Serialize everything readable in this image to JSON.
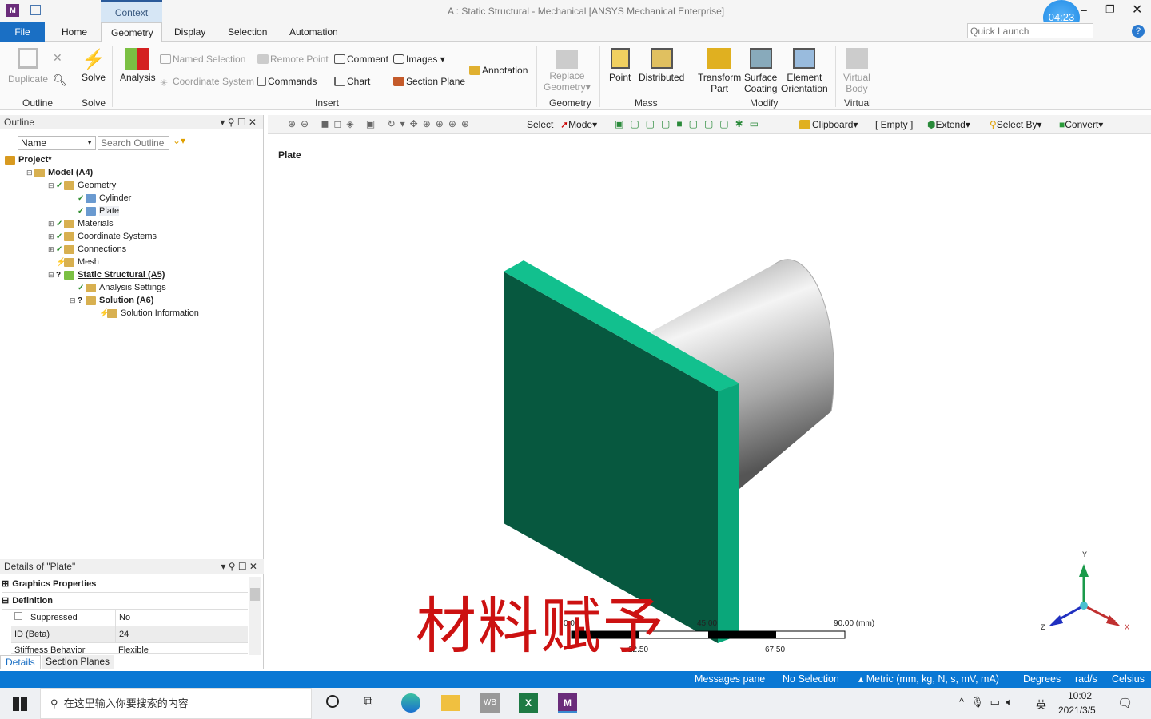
{
  "window": {
    "title": "A : Static Structural - Mechanical [ANSYS Mechanical Enterprise]",
    "context_tab": "Context",
    "timer": "04:23",
    "quick_launch_placeholder": "Quick Launch"
  },
  "tabs": [
    "File",
    "Home",
    "Geometry",
    "Display",
    "Selection",
    "Automation"
  ],
  "ribbon": {
    "outline": {
      "duplicate": "Duplicate",
      "group": "Outline"
    },
    "solve": {
      "solve": "Solve",
      "group": "Solve"
    },
    "insert": {
      "analysis": "Analysis",
      "named_selection": "Named Selection",
      "coordinate_system": "Coordinate System",
      "remote_point": "Remote Point",
      "commands": "Commands",
      "comment": "Comment",
      "chart": "Chart",
      "images": "Images",
      "section_plane": "Section Plane",
      "annotation": "Annotation",
      "group": "Insert"
    },
    "geometry": {
      "replace": "Replace",
      "geometry": "Geometry",
      "group": "Geometry"
    },
    "mass": {
      "point": "Point",
      "distributed": "Distributed",
      "group": "Mass"
    },
    "modify": {
      "transform1": "Transform",
      "transform2": "Part",
      "surface1": "Surface",
      "surface2": "Coating",
      "element1": "Element",
      "element2": "Orientation",
      "group": "Modify"
    },
    "virtual": {
      "v1": "Virtual",
      "v2": "Body",
      "group": "Virtual"
    }
  },
  "toolbar": {
    "select": "Select",
    "mode": "Mode",
    "clipboard": "Clipboard",
    "empty": "[ Empty ]",
    "extend": "Extend",
    "select_by": "Select By",
    "convert": "Convert"
  },
  "outline": {
    "title": "Outline",
    "filter": "Name",
    "search_placeholder": "Search Outline",
    "tree": [
      {
        "label": "Project*",
        "bold": true,
        "depth": 0,
        "status": ""
      },
      {
        "label": "Model (A4)",
        "bold": true,
        "depth": 1,
        "status": ""
      },
      {
        "label": "Geometry",
        "depth": 2,
        "status": "ok"
      },
      {
        "label": "Cylinder",
        "depth": 3,
        "status": "ok"
      },
      {
        "label": "Plate",
        "depth": 3,
        "status": "ok"
      },
      {
        "label": "Materials",
        "depth": 2,
        "status": "ok"
      },
      {
        "label": "Coordinate Systems",
        "depth": 2,
        "status": "ok"
      },
      {
        "label": "Connections",
        "depth": 2,
        "status": "ok"
      },
      {
        "label": "Mesh",
        "depth": 2,
        "status": "pending"
      },
      {
        "label": "Static Structural (A5)",
        "bold": true,
        "depth": 2,
        "status": "unknown"
      },
      {
        "label": "Analysis Settings",
        "depth": 3,
        "status": "ok"
      },
      {
        "label": "Solution (A6)",
        "bold": true,
        "depth": 3,
        "status": "unknown"
      },
      {
        "label": "Solution Information",
        "depth": 4,
        "status": "pending"
      }
    ]
  },
  "details": {
    "title": "Details of \"Plate\"",
    "sections": [
      "Graphics Properties",
      "Definition"
    ],
    "rows": [
      {
        "k": "Suppressed",
        "v": "No"
      },
      {
        "k": "ID (Beta)",
        "v": "24"
      },
      {
        "k": "Stiffness Behavior",
        "v": "Flexible"
      }
    ],
    "tabs": [
      "Details",
      "Section Planes"
    ]
  },
  "viewport": {
    "label": "Plate",
    "overlay_text": "材料赋予",
    "scale": {
      "top": [
        "0.00",
        "45.00",
        "90.00 (mm)"
      ],
      "bottom": [
        "22.50",
        "67.50"
      ]
    },
    "axes": [
      "X",
      "Y",
      "Z"
    ],
    "plate_color": "#0aa77a",
    "overlay_color": "#cc1111"
  },
  "status": {
    "messages": "Messages pane",
    "selection": "No Selection",
    "units": "Metric (mm, kg, N, s, mV, mA)",
    "angle": "Degrees",
    "rot": "rad/s",
    "temp": "Celsius"
  },
  "taskbar": {
    "search_placeholder": "在这里输入你要搜索的内容",
    "time": "10:02",
    "date": "2021/3/5",
    "ime": "英"
  }
}
